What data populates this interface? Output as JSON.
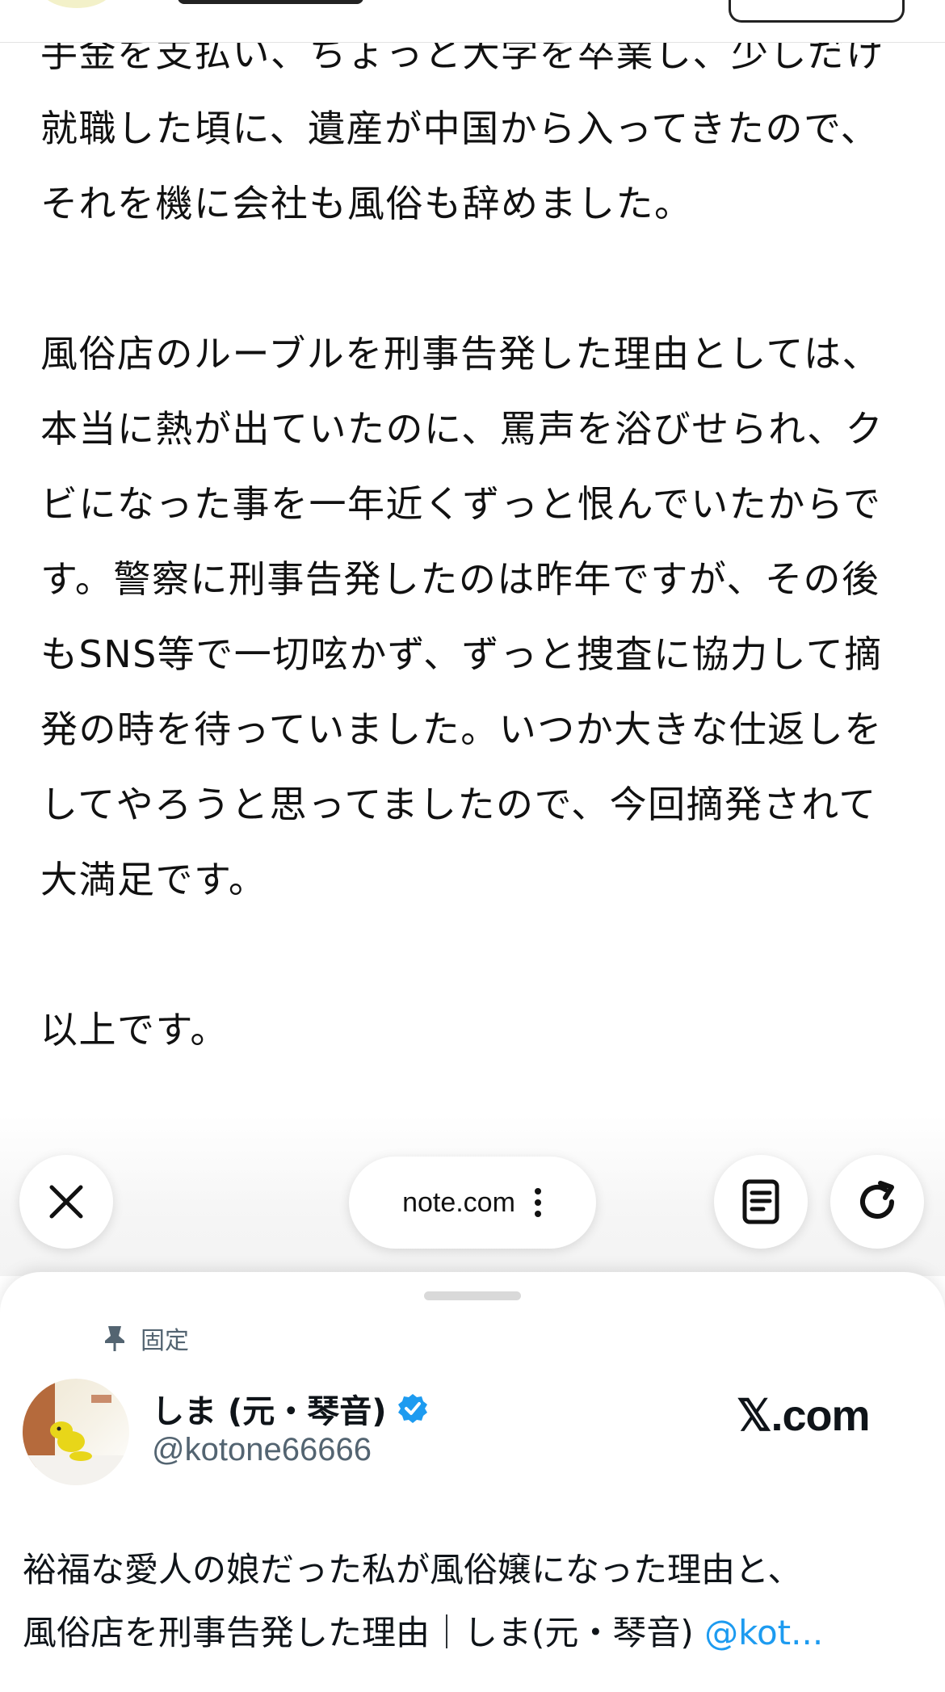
{
  "article": {
    "lines": [
      "手金を支払い、ちょっと大学を卒業し、少しだけ",
      "就職した頃に、遺産が中国から入ってきたので、",
      "それを機に会社も風俗も辞めました。",
      "",
      "風俗店のルーブルを刑事告発した理由としては、",
      "本当に熱が出ていたのに、罵声を浴びせられ、ク",
      "ビになった事を一年近くずっと恨んでいたからで",
      "す。警察に刑事告発したのは昨年ですが、その後",
      "もSNS等で一切呟かず、ずっと捜査に協力して摘",
      "発の時を待っていました。いつか大きな仕返しを",
      "してやろうと思ってましたので、今回摘発されて",
      "大満足です。",
      "",
      "以上です。"
    ]
  },
  "toolbar": {
    "url": "note.com",
    "close_icon": "close-icon",
    "menu_icon": "more-vertical-icon",
    "reader_icon": "reader-mode-icon",
    "reload_icon": "reload-icon"
  },
  "sheet": {
    "pinned_label": "固定",
    "pin_icon": "pin-icon",
    "author_name": "しま (元・琴音)",
    "verified_icon": "verified-badge-icon",
    "handle": "@kotone66666",
    "brand": "𝕏.com",
    "tweet_line1": "裕福な愛人の娘だった私が風俗嬢になった理由と、",
    "tweet_line2_prefix": "風俗店を刑事告発した理由｜しま(元・琴音) ",
    "tweet_line2_mention": "@kot..."
  },
  "colors": {
    "accent_blue": "#1d9bf0",
    "muted_gray": "#536471",
    "text": "#0f1419"
  }
}
